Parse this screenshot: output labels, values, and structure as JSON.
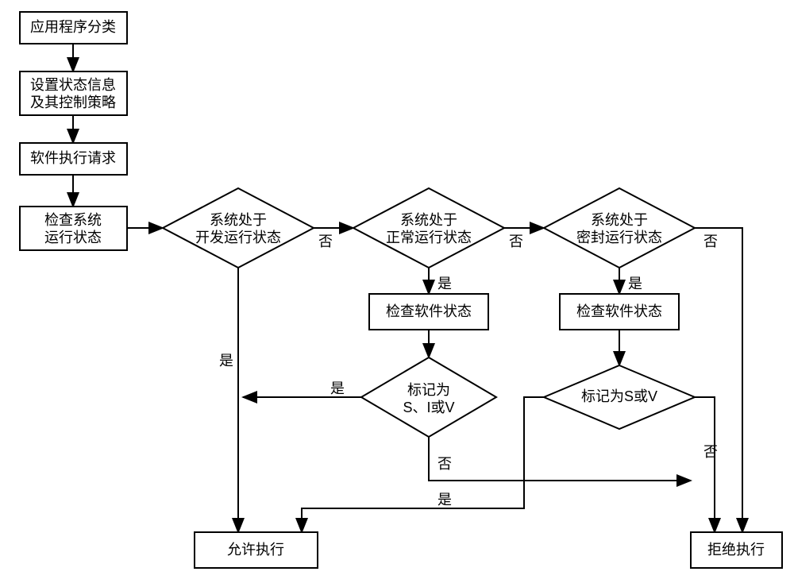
{
  "n1": "应用程序分类",
  "n2a": "设置状态信息",
  "n2b": "及其控制策略",
  "n3": "软件执行请求",
  "n4a": "检查系统",
  "n4b": "运行状态",
  "d1a": "系统处于",
  "d1b": "开发运行状态",
  "d2a": "系统处于",
  "d2b": "正常运行状态",
  "d3a": "系统处于",
  "d3b": "密封运行状态",
  "c2": "检查软件状态",
  "c3": "检查软件状态",
  "m2a": "标记为",
  "m2b": "S、I或V",
  "m3": "标记为S或V",
  "allow": "允许执行",
  "deny": "拒绝执行",
  "yes": "是",
  "no": "否"
}
